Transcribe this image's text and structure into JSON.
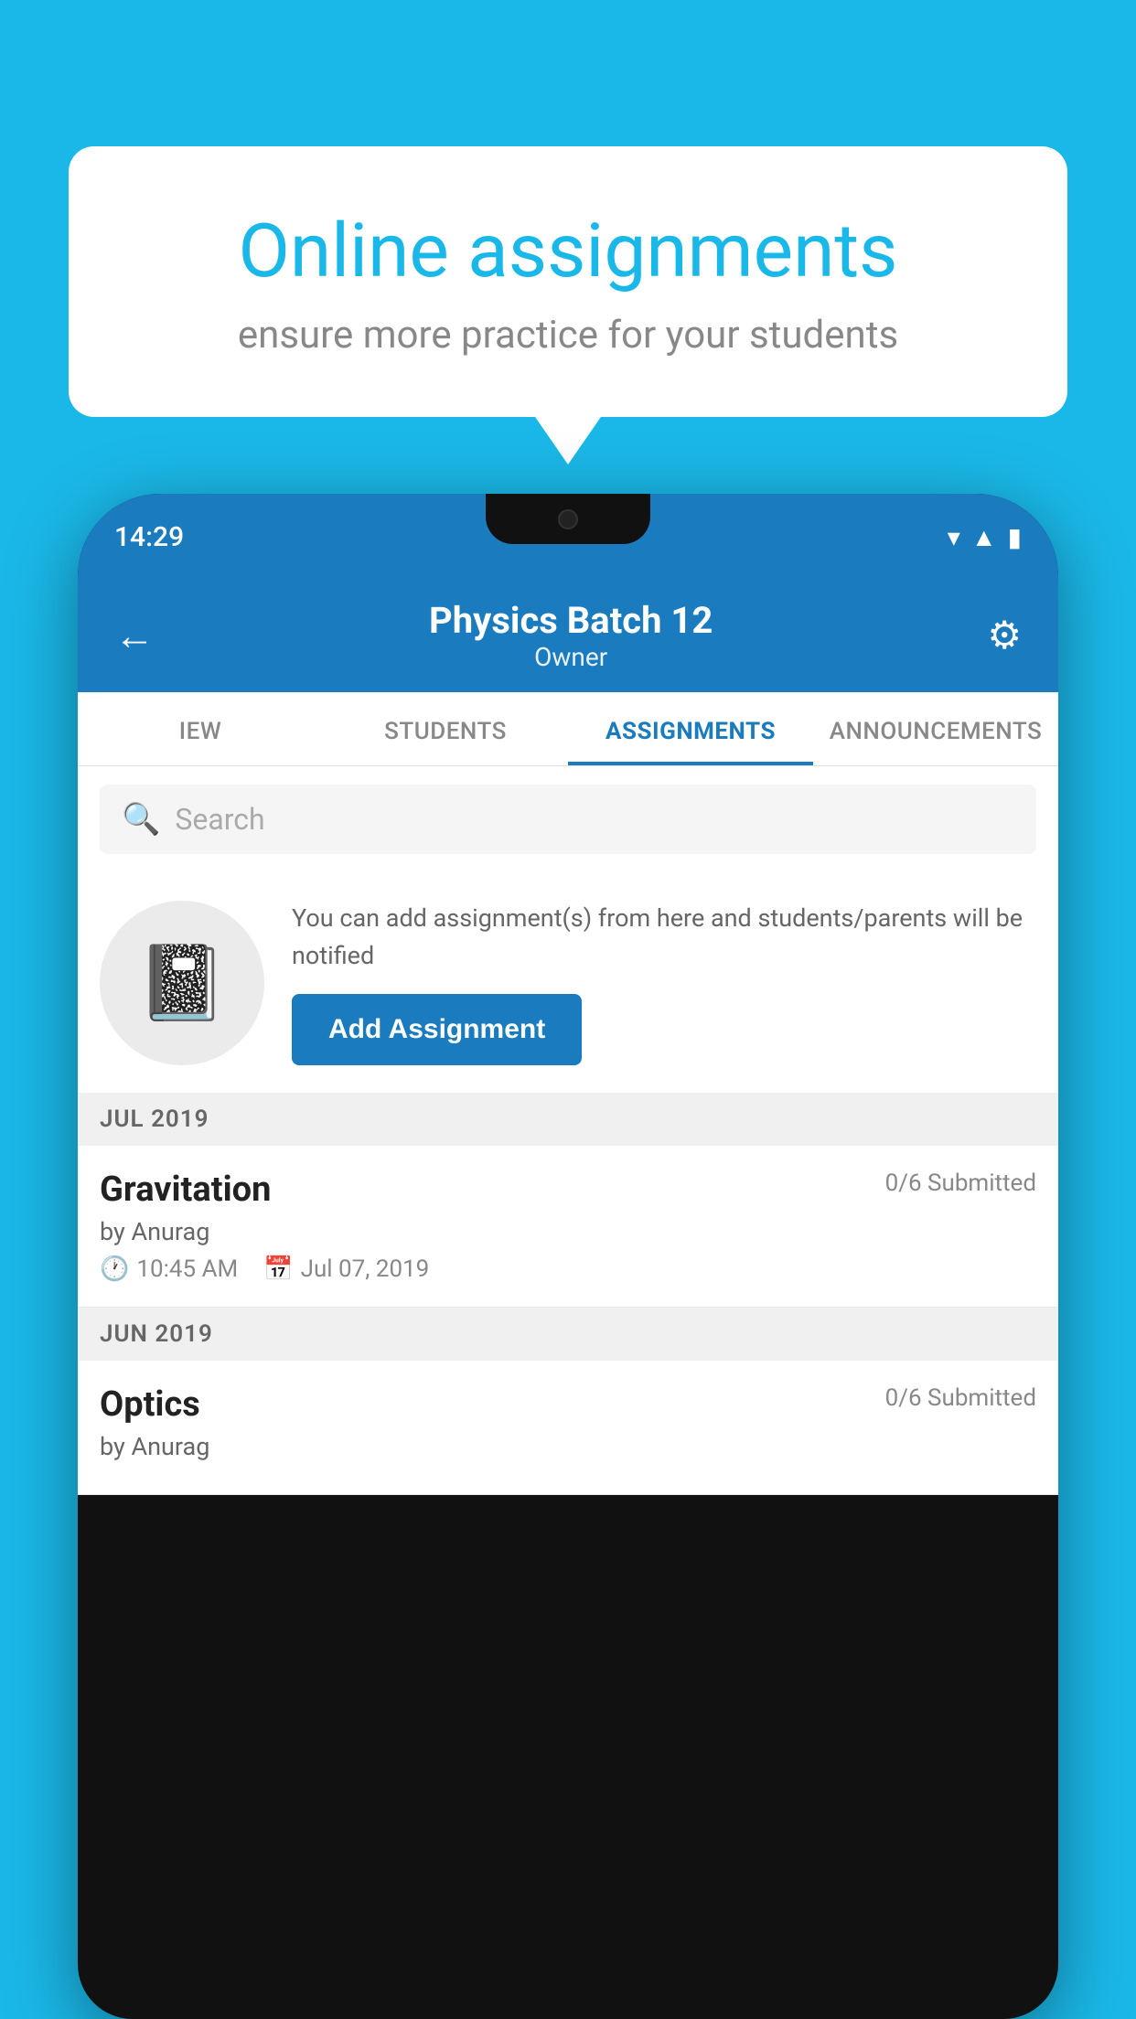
{
  "background": {
    "color": "#1ab8e8"
  },
  "speech_bubble": {
    "title": "Online assignments",
    "subtitle": "ensure more practice for your students"
  },
  "phone": {
    "status_bar": {
      "time": "14:29"
    },
    "header": {
      "title": "Physics Batch 12",
      "subtitle": "Owner",
      "back_label": "←",
      "gear_label": "⚙"
    },
    "tabs": [
      {
        "label": "IEW",
        "active": false
      },
      {
        "label": "STUDENTS",
        "active": false
      },
      {
        "label": "ASSIGNMENTS",
        "active": true
      },
      {
        "label": "ANNOUNCEMENTS",
        "active": false
      }
    ],
    "search": {
      "placeholder": "Search"
    },
    "promo": {
      "description": "You can add assignment(s) from here and students/parents will be notified",
      "button_label": "Add Assignment"
    },
    "sections": [
      {
        "label": "JUL 2019",
        "assignments": [
          {
            "title": "Gravitation",
            "submitted": "0/6 Submitted",
            "by": "by Anurag",
            "time": "10:45 AM",
            "date": "Jul 07, 2019"
          }
        ]
      },
      {
        "label": "JUN 2019",
        "assignments": [
          {
            "title": "Optics",
            "submitted": "0/6 Submitted",
            "by": "by Anurag",
            "time": "",
            "date": ""
          }
        ]
      }
    ]
  }
}
